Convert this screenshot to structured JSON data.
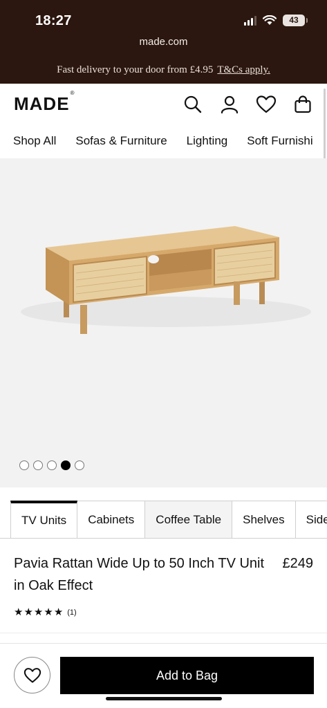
{
  "status_bar": {
    "time": "18:27",
    "battery": "43"
  },
  "browser": {
    "url": "made.com"
  },
  "promo": {
    "text": "Fast delivery to your door from £4.95",
    "link": "T&Cs apply."
  },
  "header": {
    "logo": "MADE",
    "logo_mark": "®",
    "icons": [
      "search-icon",
      "account-icon",
      "wishlist-icon",
      "bag-icon"
    ]
  },
  "nav": {
    "items": [
      "Shop All",
      "Sofas & Furniture",
      "Lighting",
      "Soft Furnishi"
    ]
  },
  "gallery": {
    "image_count": 5,
    "active_index": 3
  },
  "categories": [
    {
      "label": "TV Units",
      "active": true
    },
    {
      "label": "Cabinets",
      "active": false
    },
    {
      "label": "Coffee Table",
      "active": false
    },
    {
      "label": "Shelves",
      "active": false
    },
    {
      "label": "Side",
      "active": false
    }
  ],
  "product": {
    "title": "Pavia Rattan Wide Up to 50 Inch TV Unit in Oak Effect",
    "price": "£249",
    "rating": 5,
    "review_count": "(1)"
  },
  "actions": {
    "add_to_bag": "Add to Bag"
  },
  "colors": {
    "chrome_bg": "#2b170f",
    "button_bg": "#000000",
    "oak": "#d9b27a",
    "rattan": "#e3c99a"
  }
}
